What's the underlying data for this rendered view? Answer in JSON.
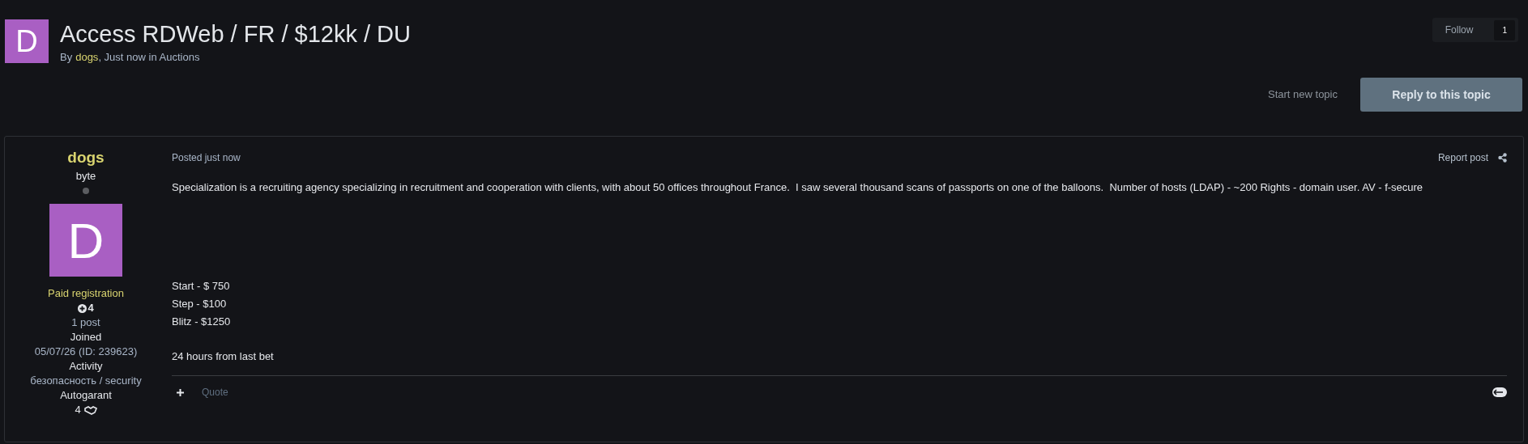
{
  "topic": {
    "avatar_letter": "D",
    "title": "Access RDWeb / FR / $12kk / DU",
    "byline_prefix": "By",
    "author": "dogs",
    "byline_suffix": ", Just now in Auctions"
  },
  "follow": {
    "label": "Follow",
    "count": "1"
  },
  "actions": {
    "start_new": "Start new topic",
    "reply": "Reply to this topic"
  },
  "author_panel": {
    "name": "dogs",
    "rank": "byte",
    "online": false,
    "avatar_letter": "D",
    "group": "Paid registration",
    "reputation": "4",
    "posts": "1 post",
    "fields": [
      {
        "label": "Joined",
        "value": "05/07/26 (ID: 239623)"
      },
      {
        "label": "Activity",
        "value": "безопасность / security"
      },
      {
        "label": "Autogarant",
        "value": "4"
      }
    ]
  },
  "post": {
    "posted": "Posted just now",
    "report": "Report post",
    "body": [
      "Specialization is a recruiting agency specializing in recruitment and cooperation with clients, with about 50 offices throughout France.  I saw several thousand scans of passports on one of the balloons.  Number of hosts (LDAP) - ~200 Rights - domain user. AV - f-secure"
    ],
    "terms": [
      "Start - $ 750",
      "Step - $100",
      "Blitz - $1250"
    ],
    "note": "24 hours from last bet",
    "quote": "Quote"
  }
}
